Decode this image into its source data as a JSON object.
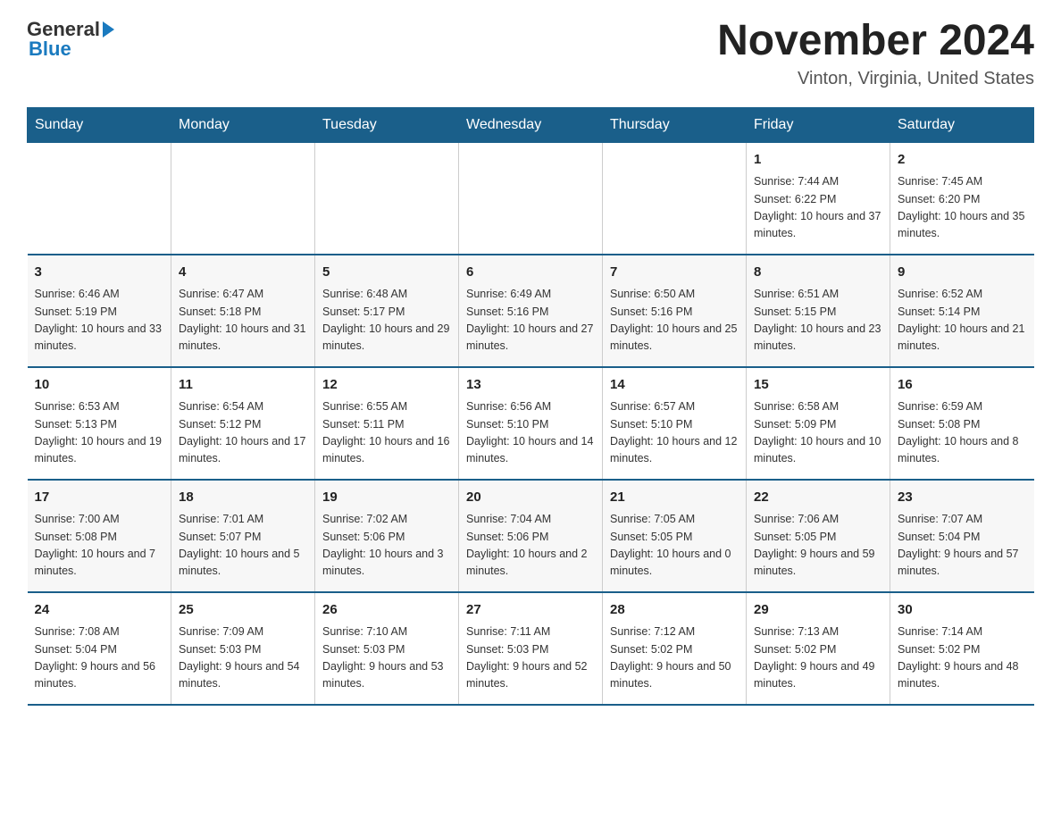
{
  "header": {
    "logo": {
      "general": "General",
      "arrow": "▶",
      "blue": "Blue"
    },
    "title": "November 2024",
    "location": "Vinton, Virginia, United States"
  },
  "calendar": {
    "days_of_week": [
      "Sunday",
      "Monday",
      "Tuesday",
      "Wednesday",
      "Thursday",
      "Friday",
      "Saturday"
    ],
    "weeks": [
      [
        {
          "day": "",
          "info": ""
        },
        {
          "day": "",
          "info": ""
        },
        {
          "day": "",
          "info": ""
        },
        {
          "day": "",
          "info": ""
        },
        {
          "day": "",
          "info": ""
        },
        {
          "day": "1",
          "info": "Sunrise: 7:44 AM\nSunset: 6:22 PM\nDaylight: 10 hours and 37 minutes."
        },
        {
          "day": "2",
          "info": "Sunrise: 7:45 AM\nSunset: 6:20 PM\nDaylight: 10 hours and 35 minutes."
        }
      ],
      [
        {
          "day": "3",
          "info": "Sunrise: 6:46 AM\nSunset: 5:19 PM\nDaylight: 10 hours and 33 minutes."
        },
        {
          "day": "4",
          "info": "Sunrise: 6:47 AM\nSunset: 5:18 PM\nDaylight: 10 hours and 31 minutes."
        },
        {
          "day": "5",
          "info": "Sunrise: 6:48 AM\nSunset: 5:17 PM\nDaylight: 10 hours and 29 minutes."
        },
        {
          "day": "6",
          "info": "Sunrise: 6:49 AM\nSunset: 5:16 PM\nDaylight: 10 hours and 27 minutes."
        },
        {
          "day": "7",
          "info": "Sunrise: 6:50 AM\nSunset: 5:16 PM\nDaylight: 10 hours and 25 minutes."
        },
        {
          "day": "8",
          "info": "Sunrise: 6:51 AM\nSunset: 5:15 PM\nDaylight: 10 hours and 23 minutes."
        },
        {
          "day": "9",
          "info": "Sunrise: 6:52 AM\nSunset: 5:14 PM\nDaylight: 10 hours and 21 minutes."
        }
      ],
      [
        {
          "day": "10",
          "info": "Sunrise: 6:53 AM\nSunset: 5:13 PM\nDaylight: 10 hours and 19 minutes."
        },
        {
          "day": "11",
          "info": "Sunrise: 6:54 AM\nSunset: 5:12 PM\nDaylight: 10 hours and 17 minutes."
        },
        {
          "day": "12",
          "info": "Sunrise: 6:55 AM\nSunset: 5:11 PM\nDaylight: 10 hours and 16 minutes."
        },
        {
          "day": "13",
          "info": "Sunrise: 6:56 AM\nSunset: 5:10 PM\nDaylight: 10 hours and 14 minutes."
        },
        {
          "day": "14",
          "info": "Sunrise: 6:57 AM\nSunset: 5:10 PM\nDaylight: 10 hours and 12 minutes."
        },
        {
          "day": "15",
          "info": "Sunrise: 6:58 AM\nSunset: 5:09 PM\nDaylight: 10 hours and 10 minutes."
        },
        {
          "day": "16",
          "info": "Sunrise: 6:59 AM\nSunset: 5:08 PM\nDaylight: 10 hours and 8 minutes."
        }
      ],
      [
        {
          "day": "17",
          "info": "Sunrise: 7:00 AM\nSunset: 5:08 PM\nDaylight: 10 hours and 7 minutes."
        },
        {
          "day": "18",
          "info": "Sunrise: 7:01 AM\nSunset: 5:07 PM\nDaylight: 10 hours and 5 minutes."
        },
        {
          "day": "19",
          "info": "Sunrise: 7:02 AM\nSunset: 5:06 PM\nDaylight: 10 hours and 3 minutes."
        },
        {
          "day": "20",
          "info": "Sunrise: 7:04 AM\nSunset: 5:06 PM\nDaylight: 10 hours and 2 minutes."
        },
        {
          "day": "21",
          "info": "Sunrise: 7:05 AM\nSunset: 5:05 PM\nDaylight: 10 hours and 0 minutes."
        },
        {
          "day": "22",
          "info": "Sunrise: 7:06 AM\nSunset: 5:05 PM\nDaylight: 9 hours and 59 minutes."
        },
        {
          "day": "23",
          "info": "Sunrise: 7:07 AM\nSunset: 5:04 PM\nDaylight: 9 hours and 57 minutes."
        }
      ],
      [
        {
          "day": "24",
          "info": "Sunrise: 7:08 AM\nSunset: 5:04 PM\nDaylight: 9 hours and 56 minutes."
        },
        {
          "day": "25",
          "info": "Sunrise: 7:09 AM\nSunset: 5:03 PM\nDaylight: 9 hours and 54 minutes."
        },
        {
          "day": "26",
          "info": "Sunrise: 7:10 AM\nSunset: 5:03 PM\nDaylight: 9 hours and 53 minutes."
        },
        {
          "day": "27",
          "info": "Sunrise: 7:11 AM\nSunset: 5:03 PM\nDaylight: 9 hours and 52 minutes."
        },
        {
          "day": "28",
          "info": "Sunrise: 7:12 AM\nSunset: 5:02 PM\nDaylight: 9 hours and 50 minutes."
        },
        {
          "day": "29",
          "info": "Sunrise: 7:13 AM\nSunset: 5:02 PM\nDaylight: 9 hours and 49 minutes."
        },
        {
          "day": "30",
          "info": "Sunrise: 7:14 AM\nSunset: 5:02 PM\nDaylight: 9 hours and 48 minutes."
        }
      ]
    ]
  }
}
